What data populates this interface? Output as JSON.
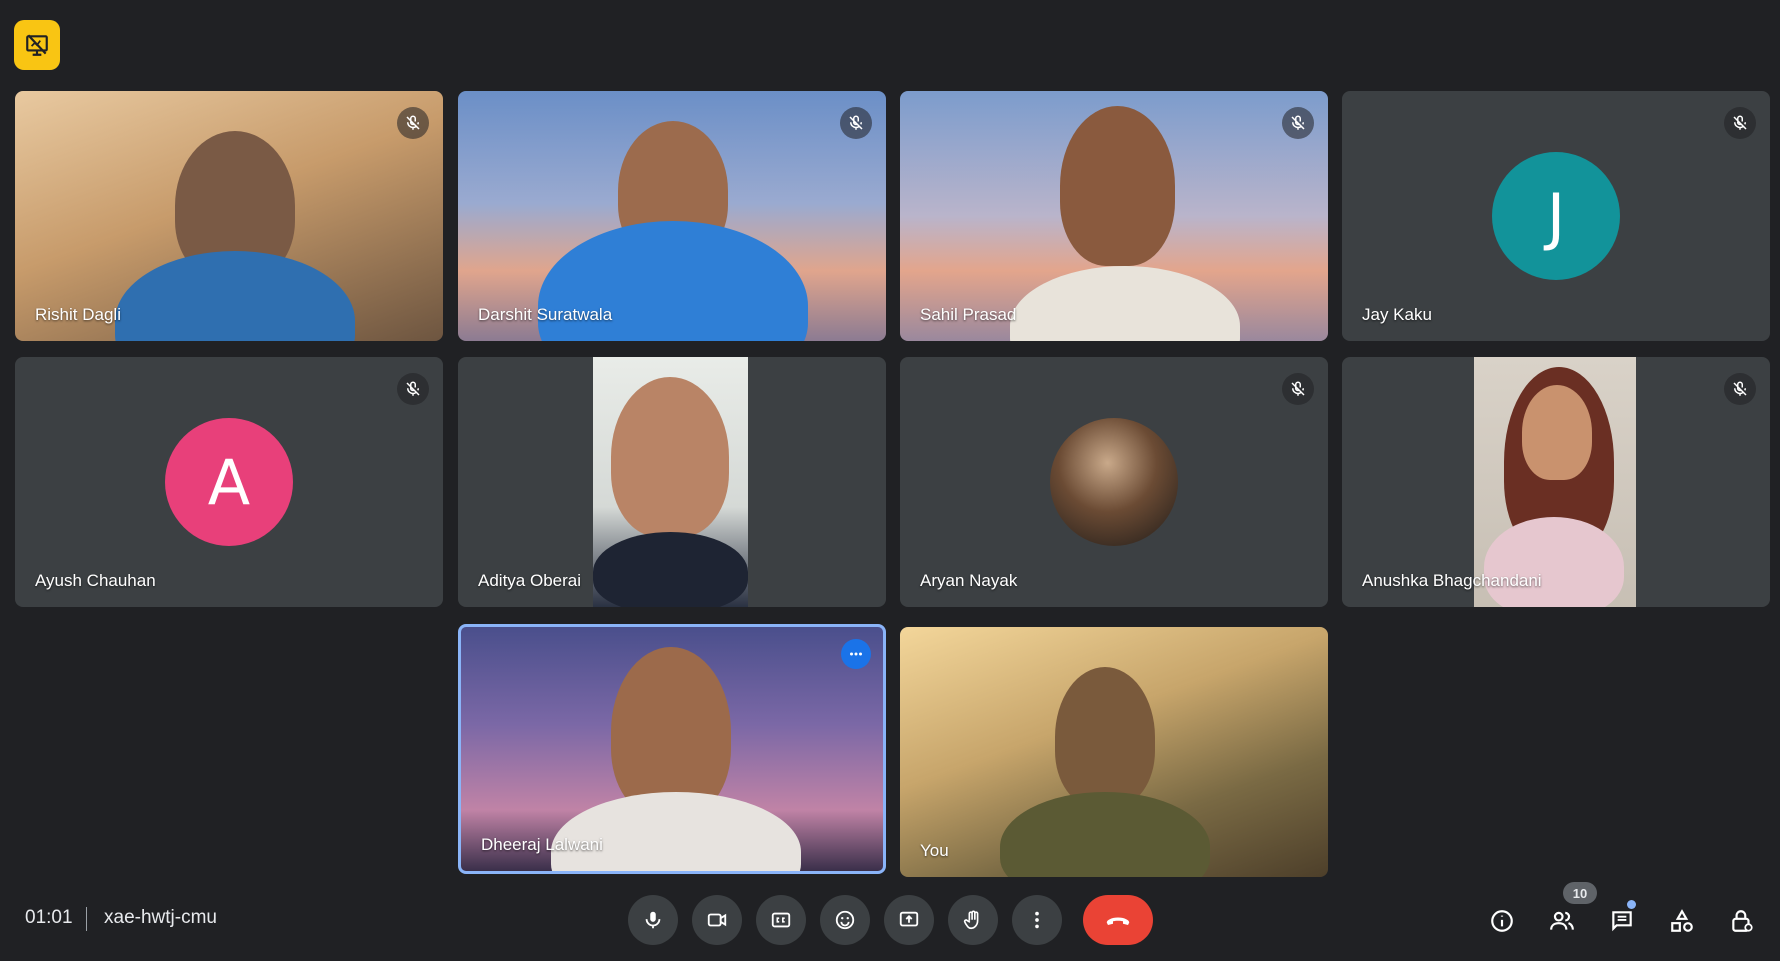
{
  "top_badge": {
    "icon": "present-off-icon",
    "color": "#f9c513"
  },
  "participants": [
    {
      "name": "Rishit Dagli",
      "type": "video",
      "muted": true
    },
    {
      "name": "Darshit Suratwala",
      "type": "video",
      "muted": true
    },
    {
      "name": "Sahil Prasad",
      "type": "video",
      "muted": true
    },
    {
      "name": "Jay Kaku",
      "type": "avatar",
      "initial": "J",
      "avatar_color": "#12939a",
      "muted": true
    },
    {
      "name": "Ayush Chauhan",
      "type": "avatar",
      "initial": "A",
      "avatar_color": "#e8407a",
      "muted": true
    },
    {
      "name": "Aditya Oberai",
      "type": "video",
      "muted": false
    },
    {
      "name": "Aryan Nayak",
      "type": "photo-avatar",
      "muted": true
    },
    {
      "name": "Anushka Bhagchandani",
      "type": "video",
      "muted": true
    },
    {
      "name": "Dheeraj Lalwani",
      "type": "video",
      "speaking": true,
      "muted": false
    },
    {
      "name": "You",
      "type": "video",
      "muted": false
    }
  ],
  "meeting": {
    "time": "01:01",
    "code": "xae-hwtj-cmu"
  },
  "controls": [
    {
      "name": "microphone",
      "icon": "mic-icon"
    },
    {
      "name": "camera",
      "icon": "camera-icon"
    },
    {
      "name": "captions",
      "icon": "cc-icon"
    },
    {
      "name": "reactions",
      "icon": "emoji-icon"
    },
    {
      "name": "present",
      "icon": "present-icon"
    },
    {
      "name": "raise-hand",
      "icon": "hand-icon"
    },
    {
      "name": "more-options",
      "icon": "more-vert-icon"
    },
    {
      "name": "leave-call",
      "icon": "end-call-icon",
      "color": "#ea4335"
    }
  ],
  "right_controls": {
    "participant_count": "10",
    "items": [
      "info-icon",
      "people-icon",
      "chat-icon",
      "activities-icon",
      "host-controls-icon"
    ]
  },
  "colors": {
    "background": "#202124",
    "tile": "#3c4043",
    "speaking_border": "#8ab4f8"
  }
}
